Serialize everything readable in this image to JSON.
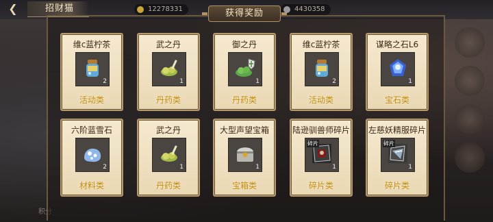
{
  "window": {
    "title": "招财猫"
  },
  "header": {
    "resource_1": "12278331",
    "resource_2": "4430358"
  },
  "side_label": "积分",
  "modal": {
    "title": "获得奖励",
    "rewards": [
      {
        "name": "维c蓝柠茶",
        "count": "2",
        "type": "活动类",
        "icon": "blue-lemon-tea-bottle-icon"
      },
      {
        "name": "武之丹",
        "count": "1",
        "type": "丹药类",
        "icon": "yellow-pill-icon"
      },
      {
        "name": "御之丹",
        "count": "1",
        "type": "丹药类",
        "icon": "green-pill-shield-icon"
      },
      {
        "name": "维c蓝柠茶",
        "count": "2",
        "type": "活动类",
        "icon": "blue-lemon-tea-bottle-icon"
      },
      {
        "name": "谋略之石L6",
        "count": "1",
        "type": "宝石类",
        "icon": "blue-gem-icon"
      },
      {
        "name": "六阶蓝雪石",
        "count": "2",
        "type": "材料类",
        "icon": "blue-snow-stone-icon"
      },
      {
        "name": "武之丹",
        "count": "1",
        "type": "丹药类",
        "icon": "yellow-pill-icon"
      },
      {
        "name": "大型声望宝箱",
        "count": "1",
        "type": "宝箱类",
        "icon": "treasure-chest-icon"
      },
      {
        "name": "陆逊驯兽师碎片",
        "count": "1",
        "type": "碎片类",
        "icon": "character-fragment-icon"
      },
      {
        "name": "左慈妖精服碎片",
        "count": "1",
        "type": "碎片类",
        "icon": "outfit-fragment-icon"
      }
    ],
    "fragment_tag": "碎片"
  },
  "colors": {
    "card_bg": "#f1e3c5",
    "type_text": "#c08a12",
    "slot_bg": "#4a4540"
  }
}
